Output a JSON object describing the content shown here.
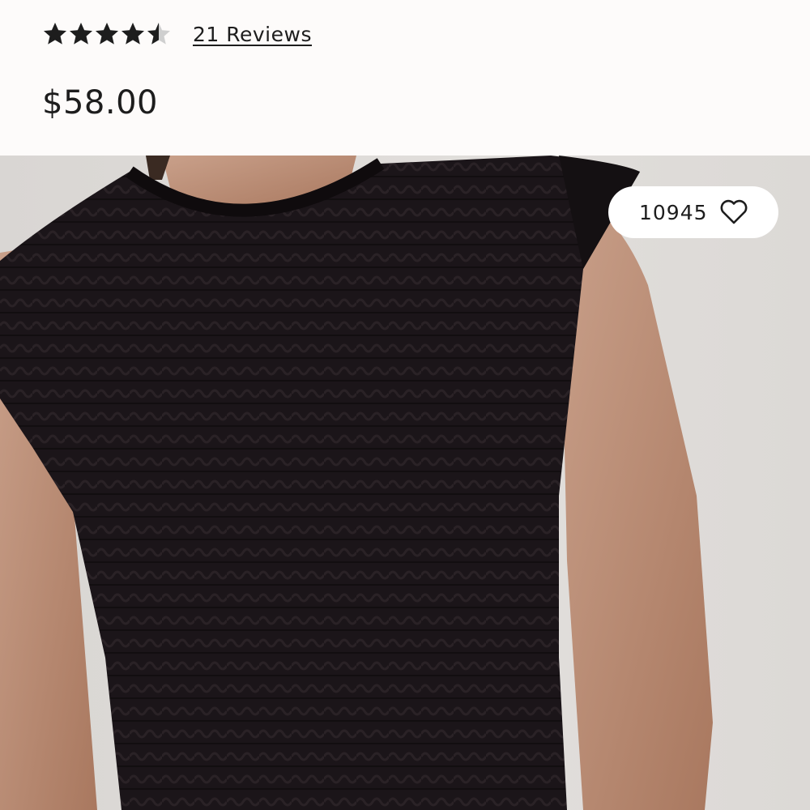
{
  "product": {
    "rating": 4.5,
    "rating_max": 5,
    "reviews_label": "21 Reviews",
    "price": "$58.00"
  },
  "favorites": {
    "count": "10945",
    "icon": "heart-outline-icon"
  },
  "image": {
    "subject": "black smocked cap-sleeve top",
    "background_color": "#dedbd8",
    "garment_color": "#1b1519"
  }
}
